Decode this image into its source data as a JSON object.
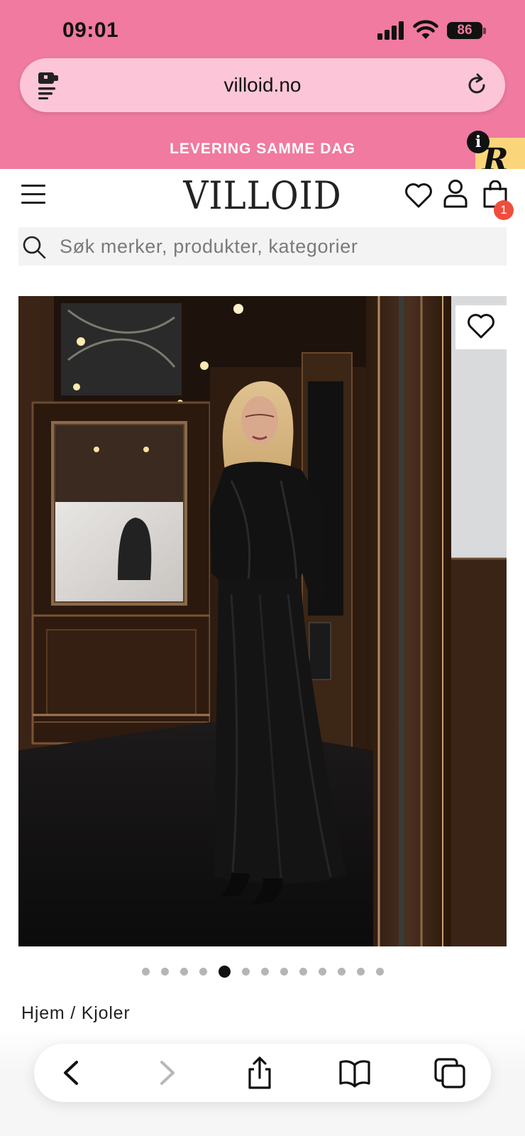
{
  "status_bar": {
    "time": "09:01",
    "battery": "86"
  },
  "browser": {
    "url": "villoid.no"
  },
  "promo": {
    "text": "LEVERING SAMME DAG"
  },
  "badge": {
    "letter": "R",
    "info": "i"
  },
  "header": {
    "logo": "VILLOID",
    "cart_count": "1"
  },
  "search": {
    "placeholder": "Søk merker, produkter, kategorier"
  },
  "carousel": {
    "total": 13,
    "active_index": 4
  },
  "breadcrumb": {
    "items": [
      "Hjem",
      "Kjoler"
    ],
    "separator": " / "
  },
  "colors": {
    "brand_pink": "#f07aa0",
    "url_bar_pink": "#fcc6d8",
    "badge_yellow": "#fbd57a",
    "cart_badge": "#ef4d3d"
  },
  "icons": [
    "signal-icon",
    "wifi-icon",
    "battery-icon",
    "site-settings-icon",
    "reload-icon",
    "menu-icon",
    "heart-icon",
    "user-icon",
    "bag-icon",
    "search-icon",
    "back-icon",
    "forward-icon",
    "share-icon",
    "bookmarks-icon",
    "tabs-icon"
  ]
}
